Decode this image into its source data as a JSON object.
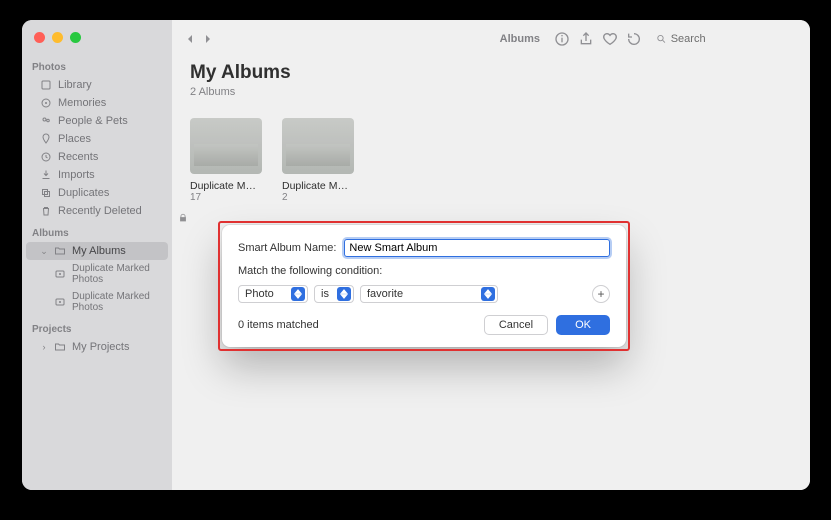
{
  "sidebar": {
    "sections": [
      {
        "header": "Photos",
        "items": [
          {
            "label": "Library",
            "icon": "library"
          },
          {
            "label": "Memories",
            "icon": "memories"
          },
          {
            "label": "People & Pets",
            "icon": "people"
          },
          {
            "label": "Places",
            "icon": "places"
          },
          {
            "label": "Recents",
            "icon": "clock"
          },
          {
            "label": "Imports",
            "icon": "imports"
          },
          {
            "label": "Duplicates",
            "icon": "duplicates"
          },
          {
            "label": "Recently Deleted",
            "icon": "trash"
          }
        ]
      },
      {
        "header": "Albums",
        "items": [
          {
            "label": "My Albums",
            "icon": "folder",
            "selected": true,
            "caret": true
          },
          {
            "label": "Duplicate Marked Photos",
            "icon": "smart",
            "sub": true
          },
          {
            "label": "Duplicate Marked Photos",
            "icon": "smart",
            "sub": true
          }
        ]
      },
      {
        "header": "Projects",
        "items": [
          {
            "label": "My Projects",
            "icon": "folder",
            "caret": true,
            "caretRight": true
          }
        ]
      }
    ]
  },
  "toolbar": {
    "view_label": "Albums",
    "search_placeholder": "Search"
  },
  "main": {
    "title": "My Albums",
    "subtitle": "2 Albums",
    "albums": [
      {
        "name": "Duplicate M…",
        "count": "17"
      },
      {
        "name": "Duplicate M…",
        "count": "2"
      }
    ]
  },
  "sheet": {
    "name_label": "Smart Album Name:",
    "name_value": "New Smart Album",
    "match_label": "Match the following condition:",
    "cond_field": "Photo",
    "cond_op": "is",
    "cond_value": "favorite",
    "matched_text": "0 items matched",
    "cancel": "Cancel",
    "ok": "OK"
  }
}
